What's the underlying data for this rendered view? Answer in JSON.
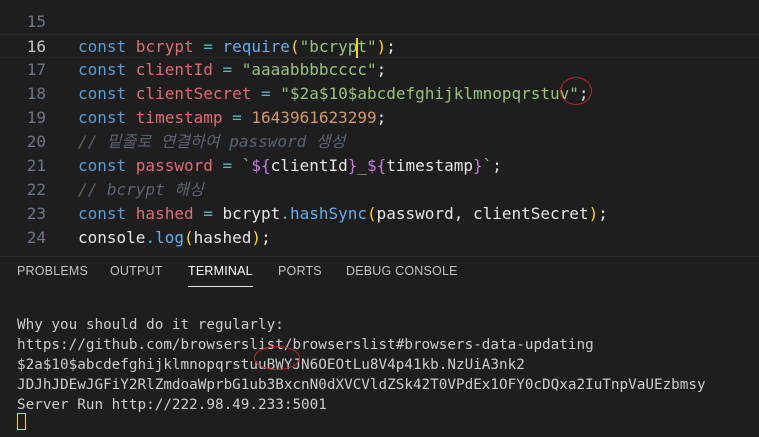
{
  "editor": {
    "lines": [
      {
        "num": "15",
        "tokens": []
      },
      {
        "num": "16",
        "active": true,
        "tokens": [
          {
            "t": "const ",
            "c": "kw2"
          },
          {
            "t": "bcrypt",
            "c": "var"
          },
          {
            "t": " = ",
            "c": "op"
          },
          {
            "t": "require",
            "c": "fn"
          },
          {
            "t": "(",
            "c": "brk"
          },
          {
            "t": "\"bcrypt\"",
            "c": "str"
          },
          {
            "t": ")",
            "c": "brk"
          },
          {
            "t": ";",
            "c": "plain"
          }
        ]
      },
      {
        "num": "17",
        "tokens": [
          {
            "t": "const ",
            "c": "kw2"
          },
          {
            "t": "clientId",
            "c": "var"
          },
          {
            "t": " = ",
            "c": "op"
          },
          {
            "t": "\"aaaabbbbcccc\"",
            "c": "str"
          },
          {
            "t": ";",
            "c": "plain"
          }
        ]
      },
      {
        "num": "18",
        "tokens": [
          {
            "t": "const ",
            "c": "kw2"
          },
          {
            "t": "clientSecret",
            "c": "var"
          },
          {
            "t": " = ",
            "c": "op"
          },
          {
            "t": "\"$2a$10$abcdefghijklmnopqrstuv\"",
            "c": "str"
          },
          {
            "t": ";",
            "c": "plain"
          }
        ]
      },
      {
        "num": "19",
        "tokens": [
          {
            "t": "const ",
            "c": "kw2"
          },
          {
            "t": "timestamp",
            "c": "var"
          },
          {
            "t": " = ",
            "c": "op"
          },
          {
            "t": "1643961623299",
            "c": "num"
          },
          {
            "t": ";",
            "c": "plain"
          }
        ]
      },
      {
        "num": "20",
        "tokens": [
          {
            "t": "// 밑줄로 연결하여 password 생성",
            "c": "cmt"
          }
        ]
      },
      {
        "num": "21",
        "tokens": [
          {
            "t": "const ",
            "c": "kw2"
          },
          {
            "t": "password",
            "c": "var"
          },
          {
            "t": " = ",
            "c": "op"
          },
          {
            "t": "`",
            "c": "str"
          },
          {
            "t": "${",
            "c": "tpl"
          },
          {
            "t": "clientId",
            "c": "plain"
          },
          {
            "t": "}",
            "c": "tpl"
          },
          {
            "t": "_",
            "c": "str"
          },
          {
            "t": "${",
            "c": "tpl"
          },
          {
            "t": "timestamp",
            "c": "plain"
          },
          {
            "t": "}",
            "c": "tpl"
          },
          {
            "t": "`",
            "c": "str"
          },
          {
            "t": ";",
            "c": "plain"
          }
        ]
      },
      {
        "num": "22",
        "tokens": [
          {
            "t": "// bcrypt 해싱",
            "c": "cmt"
          }
        ]
      },
      {
        "num": "23",
        "tokens": [
          {
            "t": "const ",
            "c": "kw2"
          },
          {
            "t": "hashed",
            "c": "var"
          },
          {
            "t": " = ",
            "c": "op"
          },
          {
            "t": "bcrypt",
            "c": "plain"
          },
          {
            "t": ".",
            "c": "op"
          },
          {
            "t": "hashSync",
            "c": "fn"
          },
          {
            "t": "(",
            "c": "brk"
          },
          {
            "t": "password, clientSecret",
            "c": "plain"
          },
          {
            "t": ")",
            "c": "brk"
          },
          {
            "t": ";",
            "c": "plain"
          }
        ]
      },
      {
        "num": "24",
        "tokens": [
          {
            "t": "console",
            "c": "plain"
          },
          {
            "t": ".",
            "c": "op"
          },
          {
            "t": "log",
            "c": "fn"
          },
          {
            "t": "(",
            "c": "brk"
          },
          {
            "t": "hashed",
            "c": "plain"
          },
          {
            "t": ")",
            "c": "brk"
          },
          {
            "t": ";",
            "c": "plain"
          }
        ]
      }
    ]
  },
  "panel": {
    "tabs": [
      {
        "label": "PROBLEMS",
        "name": "tab-problems"
      },
      {
        "label": "OUTPUT",
        "name": "tab-output"
      },
      {
        "label": "TERMINAL",
        "name": "tab-terminal",
        "active": true
      },
      {
        "label": "PORTS",
        "name": "tab-ports"
      },
      {
        "label": "DEBUG CONSOLE",
        "name": "tab-debug-console"
      }
    ]
  },
  "terminal": {
    "lines": [
      "Why you should do it regularly:",
      "https://github.com/browserslist/browserslist#browsers-data-updating",
      "$2a$10$abcdefghijklmnopqrstuuBWYJN6OEOtLu8V4p41kb.NzUiA3nk2",
      "JDJhJDEwJGFiY2RlZmdoaWprbG1ub3BxcnN0dXVCVldZSk42T0VPdEx1OFY0cDQxa2IuTnpVaUEzbmsy",
      "Server Run http://222.98.49.233:5001"
    ]
  },
  "colors": {
    "background": "#1e1e1e",
    "keyword": "#569cd6",
    "variable": "#e06c75",
    "string": "#98c379",
    "number": "#d19a66",
    "annotation_circle": "#c0282d"
  }
}
